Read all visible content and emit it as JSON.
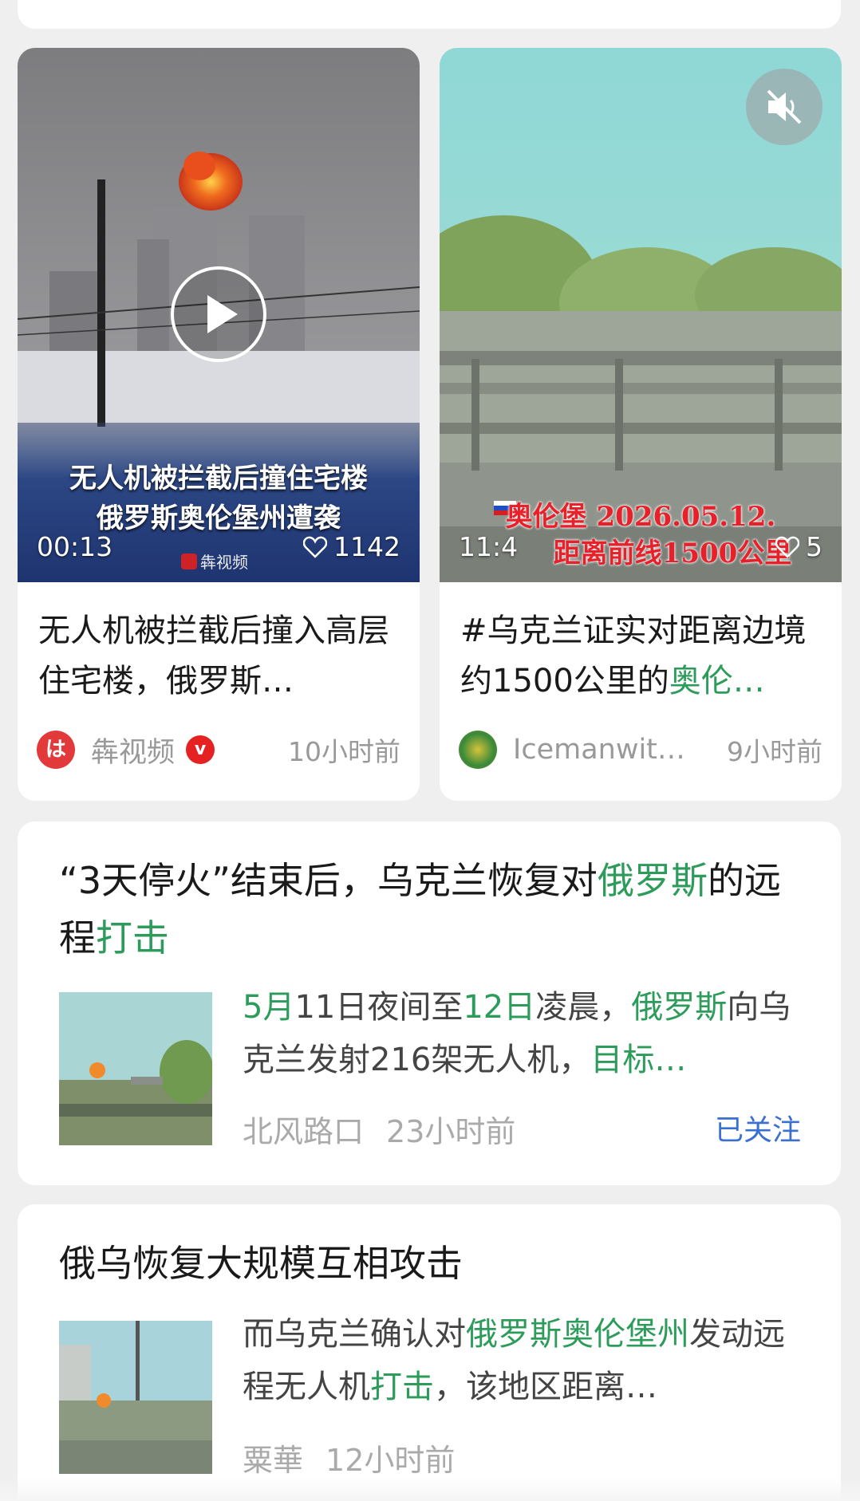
{
  "video_cards": [
    {
      "overlay_line1": "无人机被拦截后撞住宅楼",
      "overlay_line2": "俄罗斯奥伦堡州遭袭",
      "duration": "00:13",
      "likes": "1142",
      "watermark": "犇视频",
      "title": "无人机被拦截后撞入高层住宅楼，俄罗斯…",
      "author": "犇视频",
      "verified_badge": "v",
      "time": "10小时前"
    },
    {
      "overlay_line1": "奥伦堡 2026.05.12.",
      "overlay_line2": "距离前线1500公里",
      "duration": "11:4",
      "likes": "5",
      "title_prefix": "#乌克兰证实对距离边境约1500公里的",
      "title_highlight": "奥伦…",
      "author": "Icemanwit…",
      "time": "9小时前"
    }
  ],
  "articles": [
    {
      "title_part1": "“3天停火”结束后，乌克兰恢复对",
      "title_hl1": "俄罗斯",
      "title_part2": "的远程",
      "title_hl2": "打击",
      "summary_hl1": "5月",
      "summary_part1": "11日夜间至",
      "summary_hl2": "12日",
      "summary_part2": "凌晨，",
      "summary_hl3": "俄罗斯",
      "summary_part3": "向乌克兰发射216架无人机，",
      "summary_hl4": "目标…",
      "source": "北风路口",
      "time": "23小时前",
      "follow": "已关注"
    },
    {
      "title": "俄乌恢复大规模互相攻击",
      "summary_part1": "而乌克兰确认对",
      "summary_hl1": "俄罗斯奥伦堡州",
      "summary_part2": "发动远程无人机",
      "summary_hl2": "打击",
      "summary_part3": "，该地区距离…",
      "source": "粟華",
      "time": "12小时前"
    }
  ],
  "colors": {
    "highlight_green": "#2d9b5a",
    "follow_blue": "#3b6fd1",
    "verified_red": "#e52121",
    "background": "#efefef"
  },
  "icons": [
    "play-icon",
    "mute-icon",
    "heart-icon"
  ]
}
